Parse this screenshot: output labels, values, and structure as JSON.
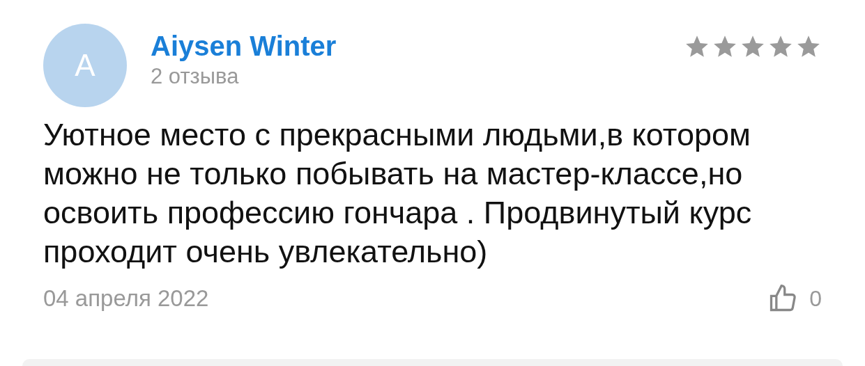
{
  "review": {
    "avatar_letter": "A",
    "author": "Aiysen Winter",
    "reviews_count": "2 отзыва",
    "stars": 5,
    "text": "Уютное место с прекрасными людьми,в котором можно не только побывать на мастер-классе,но освоить профессию гончара . Продвинутый курс проходит очень увлекательно)",
    "date": "04 апреля 2022",
    "likes": "0"
  }
}
